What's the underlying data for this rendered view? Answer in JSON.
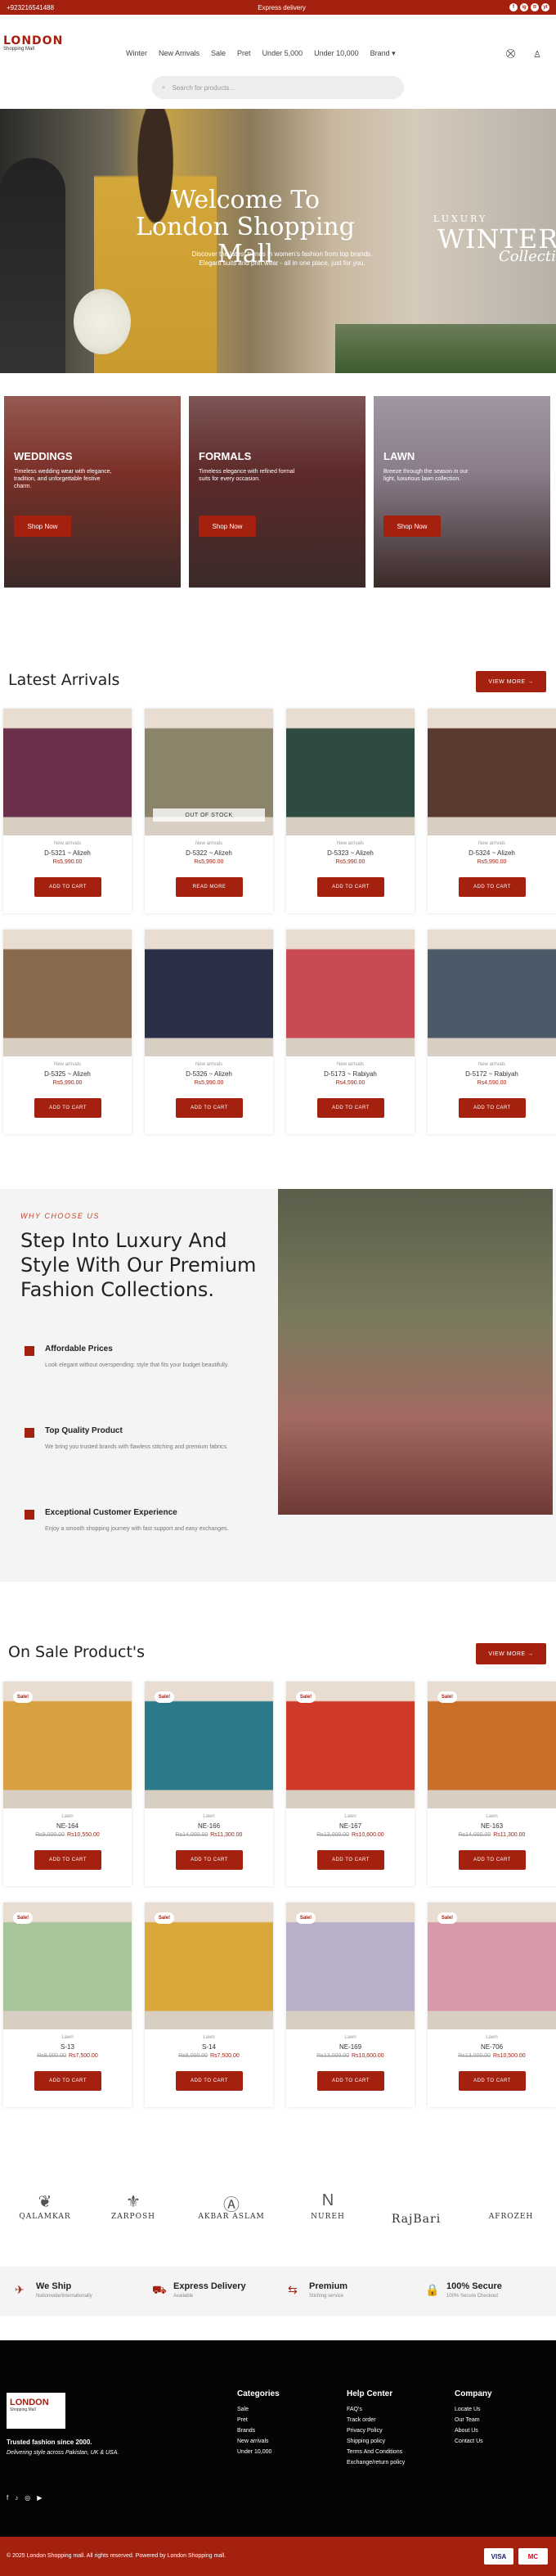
{
  "topbar": {
    "phone": "+923216541488",
    "promo": "Express delivery",
    "social": [
      "f",
      "ig",
      "tt",
      "yt"
    ]
  },
  "header": {
    "logo_main": "LONDON",
    "logo_sub": "Shopping Mall",
    "nav": [
      "Winter",
      "New Arrivals",
      "Sale",
      "Pret",
      "Under 5,000",
      "Under 10,000",
      "Brand ▾"
    ],
    "search_placeholder": "Search for products..."
  },
  "hero": {
    "title": "Welcome To London Shopping Mall",
    "subtitle": "Discover the latest trends in women's fashion from top brands. Elegant suits and pret wear - all in one place, just for you.",
    "collection_small": "LUXURY",
    "collection_big": "WINTER",
    "collection_script": "Collection"
  },
  "categories": [
    {
      "title": "WEDDINGS",
      "desc": "Timeless wedding wear with elegance, tradition, and unforgettable festive charm.",
      "button": "Shop Now",
      "color": "#7a3028"
    },
    {
      "title": "FORMALS",
      "desc": "Timeless elegance with refined formal suits for every occasion.",
      "button": "Shop Now",
      "color": "#5e2a2a"
    },
    {
      "title": "LAWN",
      "desc": "Breeze through the season in our light, luxurious lawn collection.",
      "button": "Shop Now",
      "color": "#8a7c8a"
    }
  ],
  "latest": {
    "title": "Latest Arrivals",
    "view_more": "VIEW MORE →",
    "products": [
      {
        "category": "New arrivals",
        "name": "D-5321 ~ Alizeh",
        "price": "Rs5,990.00",
        "button": "ADD TO CART",
        "color": "#6a2f4a",
        "oos": ""
      },
      {
        "category": "New arrivals",
        "name": "D-5322 ~ Alizeh",
        "price": "Rs5,990.00",
        "button": "READ MORE",
        "color": "#8b8468",
        "oos": "OUT OF STOCK"
      },
      {
        "category": "New arrivals",
        "name": "D-5323 ~ Alizeh",
        "price": "Rs5,990.00",
        "button": "ADD TO CART",
        "color": "#2f4a3e",
        "oos": ""
      },
      {
        "category": "New arrivals",
        "name": "D-5324 ~ Alizeh",
        "price": "Rs5,990.00",
        "button": "ADD TO CART",
        "color": "#5a3a30",
        "oos": ""
      },
      {
        "category": "New arrivals",
        "name": "D-5325 ~ Alizeh",
        "price": "Rs5,990.00",
        "button": "ADD TO CART",
        "color": "#8a6a4e",
        "oos": ""
      },
      {
        "category": "New arrivals",
        "name": "D-5326 ~ Alizeh",
        "price": "Rs5,990.00",
        "button": "ADD TO CART",
        "color": "#2a2f48",
        "oos": ""
      },
      {
        "category": "New arrivals",
        "name": "D-5173 ~ Rabiyah",
        "price": "Rs4,590.00",
        "button": "ADD TO CART",
        "color": "#c84a52",
        "oos": ""
      },
      {
        "category": "New arrivals",
        "name": "D-5172 ~ Rabiyah",
        "price": "Rs4,590.00",
        "button": "ADD TO CART",
        "color": "#4a5a68",
        "oos": ""
      }
    ]
  },
  "why": {
    "kicker": "WHY CHOOSE US",
    "title": "Step Into Luxury And Style With Our Premium Fashion Collections.",
    "features": [
      {
        "title": "Affordable Prices",
        "desc": "Look elegant without overspending: style that fits your budget beautifully."
      },
      {
        "title": "Top Quality Product",
        "desc": "We bring you trusted brands with flawless stitching and premium fabrics."
      },
      {
        "title": "Exceptional Customer Experience",
        "desc": "Enjoy a smooth shopping journey with fast support and easy exchanges."
      }
    ]
  },
  "sale": {
    "title": "On Sale Product's",
    "view_more": "VIEW MORE →",
    "badge": "Sale!",
    "products": [
      {
        "category": "Lawn",
        "name": "NE-164",
        "old": "Rs9,000.00",
        "price": "Rs10,550.00",
        "button": "ADD TO CART",
        "color": "#d8a040"
      },
      {
        "category": "Lawn",
        "name": "NE-166",
        "old": "Rs14,000.00",
        "price": "Rs11,300.00",
        "button": "ADD TO CART",
        "color": "#2a7a8a"
      },
      {
        "category": "Lawn",
        "name": "NE-167",
        "old": "Rs13,000.00",
        "price": "Rs10,600.00",
        "button": "ADD TO CART",
        "color": "#d03a2a"
      },
      {
        "category": "Lawn",
        "name": "NE-163",
        "old": "Rs14,000.00",
        "price": "Rs11,300.00",
        "button": "ADD TO CART",
        "color": "#c8702a"
      },
      {
        "category": "Lawn",
        "name": "S-13",
        "old": "Rs8,000.00",
        "price": "Rs7,500.00",
        "button": "ADD TO CART",
        "color": "#a8c49a"
      },
      {
        "category": "Lawn",
        "name": "S-14",
        "old": "Rs8,000.00",
        "price": "Rs7,500.00",
        "button": "ADD TO CART",
        "color": "#d8a83a"
      },
      {
        "category": "Lawn",
        "name": "NE-169",
        "old": "Rs13,000.00",
        "price": "Rs10,600.00",
        "button": "ADD TO CART",
        "color": "#b8b0c8"
      },
      {
        "category": "Lawn",
        "name": "NE-706",
        "old": "Rs13,000.00",
        "price": "Rs10,500.00",
        "button": "ADD TO CART",
        "color": "#d89aa8"
      }
    ]
  },
  "brands": [
    "QALAMKAR",
    "ZARPOSH",
    "AKBAR ASLAM",
    "NUREH",
    "RajBari",
    "AFROZEH"
  ],
  "services": [
    {
      "icon": "✈",
      "title": "We Ship",
      "desc": "Nationwide/Internationally"
    },
    {
      "icon": "⛟",
      "title": "Express Delivery",
      "desc": "Available"
    },
    {
      "icon": "⇆",
      "title": "Premium",
      "desc": "Stiching service"
    },
    {
      "icon": "🔒",
      "title": "100% Secure",
      "desc": "100% Secure Checkout"
    }
  ],
  "footer": {
    "tagline": "Trusted fashion since 2000.",
    "tagline2": "Delivering style across Pakistan, UK & USA.",
    "social": [
      "f",
      "♪",
      "◎",
      "▶"
    ],
    "columns": [
      {
        "title": "Categories",
        "items": [
          "Sale",
          "Pret",
          "Brands",
          "New arrivals",
          "Under 10,000"
        ]
      },
      {
        "title": "Help Center",
        "items": [
          "FAQ's",
          "Track order",
          "Privacy Policy",
          "Shipping policy",
          "Terms And Conditions",
          "Exchange/return policy"
        ]
      },
      {
        "title": "Company",
        "items": [
          "Locate Us",
          "Our Team",
          "About Us",
          "Contact Us"
        ]
      }
    ],
    "copyright": "© 2025 London Shopping mall. All rights reserved. Powered by London Shopping mall.",
    "payments": [
      "VISA",
      "MC"
    ]
  },
  "colors": {
    "accent": "#a4200f"
  }
}
